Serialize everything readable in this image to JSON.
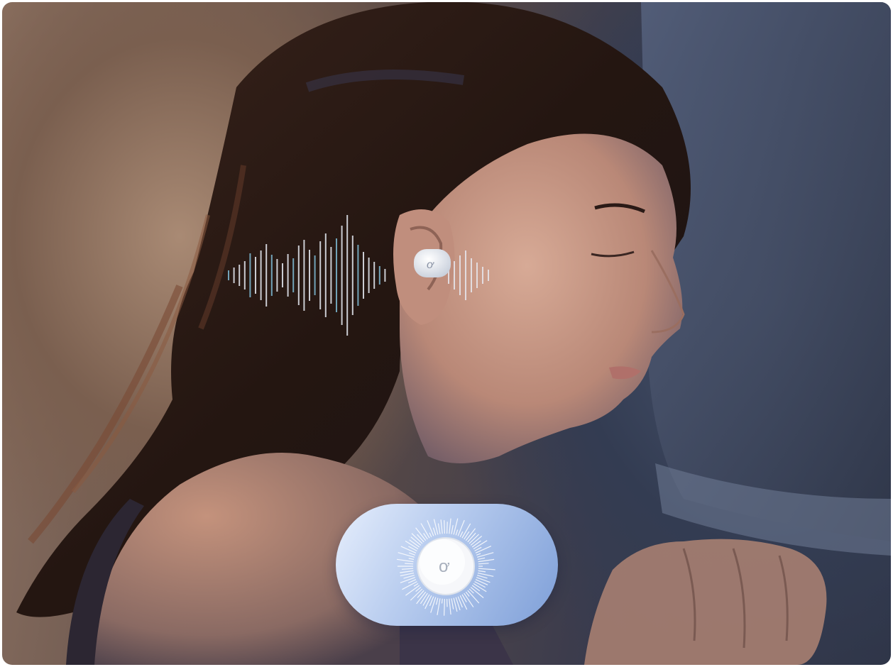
{
  "photo": {
    "subject": "person-sleeping-with-earbud",
    "palette": {
      "warm_light": "#a98a74",
      "cool_shadow": "#333c52",
      "pillow": "#5a6580",
      "skin": "#c99a86",
      "hair": "#2a1a16",
      "earbud": "#eef1f6",
      "sound_wave": "#e8ecf5",
      "sound_wave_accent": "#3aa4c8",
      "pill_light": "#e6eefc",
      "pill_dark": "#7e9fd8"
    }
  },
  "badge": {
    "icon": "earbud-logo-icon"
  }
}
